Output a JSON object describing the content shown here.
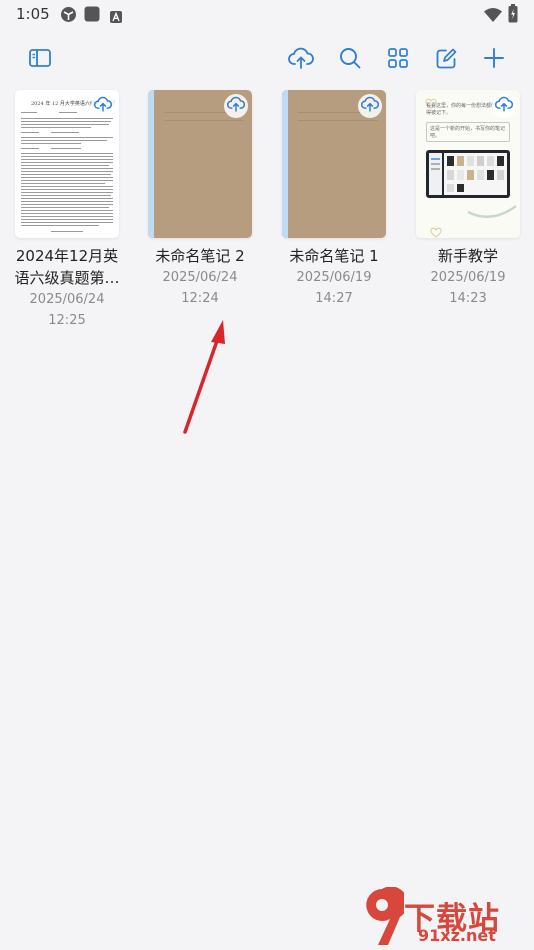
{
  "status_bar": {
    "time": "1:05"
  },
  "toolbar": {
    "icons": [
      "sidebar-icon",
      "cloud-upload-icon",
      "search-icon",
      "grid-view-icon",
      "edit-icon",
      "add-icon"
    ],
    "accent": "#2f7fd6"
  },
  "notebooks": [
    {
      "title": "2024年12月英语六级真题第…",
      "date": "2025/06/24",
      "time": "12:25",
      "cover_heading": "2024 年 12 月大学英语六级考试真题"
    },
    {
      "title": "未命名笔记 2",
      "date": "2025/06/24",
      "time": "12:24"
    },
    {
      "title": "未命名笔记 1",
      "date": "2025/06/19",
      "time": "14:27"
    },
    {
      "title": "新手教学",
      "date": "2025/06/19",
      "time": "14:23",
      "cover_text_1": "看看这里，你的每一份想法都值得被记下。",
      "cover_text_2": "这是一个新的开始，书写你的笔记吧。"
    }
  ],
  "watermark": {
    "brand": "下载站",
    "url": "91xz.net"
  },
  "colors": {
    "background": "#f4f4f6",
    "kraft": "#b79d80",
    "spine": "#bddcf1",
    "arrow": "#d8262a"
  }
}
